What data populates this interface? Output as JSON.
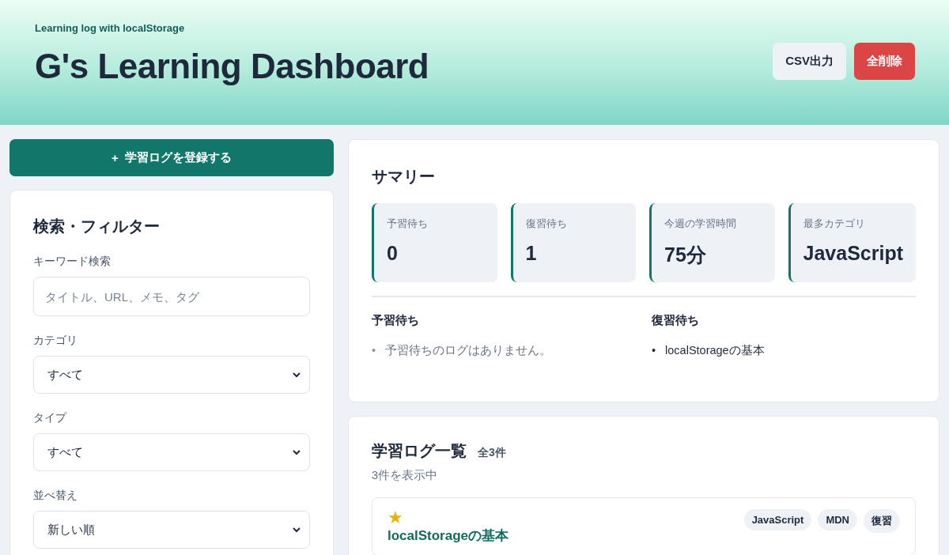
{
  "header": {
    "eyebrow": "Learning log with localStorage",
    "title": "G's Learning Dashboard",
    "buttons": [
      {
        "label": "CSV出力",
        "kind": "secondary"
      },
      {
        "label": "全削除",
        "kind": "danger"
      }
    ]
  },
  "register_button": {
    "icon": "+",
    "label": "学習ログを登録する"
  },
  "filters": {
    "title": "検索・フィルター",
    "fields": [
      {
        "kind": "input",
        "label": "キーワード検索",
        "placeholder": "タイトル、URL、メモ、タグ"
      },
      {
        "kind": "select",
        "label": "カテゴリ",
        "value": "すべて"
      },
      {
        "kind": "select",
        "label": "タイプ",
        "value": "すべて"
      },
      {
        "kind": "select",
        "label": "並べ替え",
        "value": "新しい順"
      }
    ]
  },
  "summary": {
    "title": "サマリー",
    "stats": [
      {
        "label": "予習待ち",
        "value": "0"
      },
      {
        "label": "復習待ち",
        "value": "1"
      },
      {
        "label": "今週の学習時間",
        "value": "75分"
      },
      {
        "label": "最多カテゴリ",
        "value": "JavaScript"
      }
    ],
    "lists": [
      {
        "title": "予習待ち",
        "marker": "•",
        "empty_message": "予習待ちのログはありません。"
      },
      {
        "title": "復習待ち",
        "marker": "•",
        "items": [
          "localStorageの基本"
        ]
      }
    ]
  },
  "log_list": {
    "title": "学習ログ一覧",
    "count": "全3件",
    "showing": "3件を表示中",
    "entries": [
      {
        "star": "★",
        "favorite": true,
        "title": "localStorageの基本",
        "tags": [
          "JavaScript",
          "MDN",
          "復習"
        ]
      }
    ]
  }
}
